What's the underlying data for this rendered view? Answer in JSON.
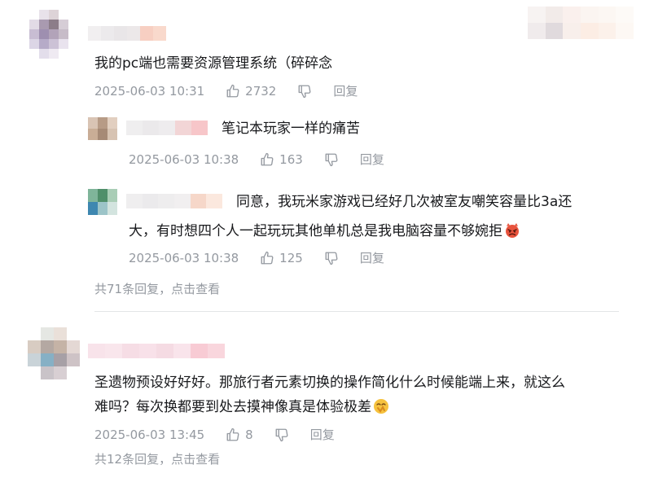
{
  "comments": [
    {
      "text": "我的pc端也需要资源管理系统（碎碎念",
      "time": "2025-06-03 10:31",
      "likes": "2732",
      "reply_label": "回复",
      "replies": [
        {
          "text": "笔记本玩家一样的痛苦",
          "time": "2025-06-03 10:38",
          "likes": "163",
          "reply_label": "回复"
        },
        {
          "text_line1": "同意，我玩米家游戏已经好几次被室友嘲笑容量比3a还",
          "text_line2": "大，有时想四个人一起玩玩其他单机总是我电脑容量不够婉拒",
          "emoji": "angry-face-emoji",
          "time": "2025-06-03 10:38",
          "likes": "125",
          "reply_label": "回复"
        }
      ],
      "more_prefix": "共71条回复，",
      "more_link": "点击查看"
    },
    {
      "text_line1": "圣遗物预设好好好。那旅行者元素切换的操作简化什么时候能端上来，就这么",
      "text_line2": "难吗？每次换都要到处去摸神像真是体验极差",
      "emoji": "clapping-face-emoji",
      "time": "2025-06-03 13:45",
      "likes": "8",
      "reply_label": "回复",
      "more_prefix": "共12条回复，",
      "more_link": "点击查看"
    }
  ],
  "colors": {
    "text": "#18191c",
    "meta": "#9499a0",
    "divider": "#e3e5e7"
  }
}
